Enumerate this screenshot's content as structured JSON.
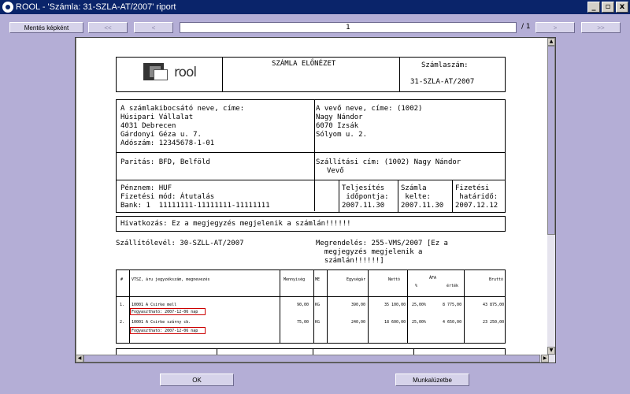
{
  "window": {
    "title": "ROOL  - 'Számla: 31-SZLA-AT/2007' riport",
    "controls": {
      "minimize": "_",
      "restore": "▫",
      "close": "x"
    }
  },
  "toolbar": {
    "save_image_label": "Mentés képként",
    "first_label": "<<",
    "prev_label": "<",
    "page_value": "1",
    "page_total": "/ 1",
    "next_label": ">",
    "last_label": ">>"
  },
  "invoice": {
    "logo_text": "rool",
    "preview_title": "SZÁMLA ELŐNÉZET",
    "invoice_no_label": "Számlaszám:",
    "invoice_no": "31-SZLA-AT/2007",
    "seller_header": "A számlakibocsátó neve, címe:",
    "seller_lines": [
      "Húsipari Vállalat",
      "4031 Debrecen",
      "Gárdonyi Géza u. 7.",
      "Adószám: 12345678-1-01"
    ],
    "buyer_header": "A vevő neve, címe: (1002)",
    "buyer_lines": [
      "Nagy Nándor",
      "6070 Izsák",
      "Sólyom u. 2."
    ],
    "parity": "Paritás: BFD, Belföld",
    "shipping_line1": "Szállítási cím: (1002) Nagy Nándor",
    "shipping_line2": "Vevő",
    "currency": "Pénznem: HUF",
    "payment_method": "Fizetési mód: Átutalás",
    "bank": "Bank: 1  11111111-11111111-11111111",
    "completion_label1": "Teljesítés",
    "completion_label2": " időpontja:",
    "completion_date": "2007.11.30",
    "issue_label1": "Számla",
    "issue_label2": " kelte:",
    "issue_date": "2007.11.30",
    "due_label1": "Fizetési",
    "due_label2": " határidő:",
    "due_date": "2007.12.12",
    "reference": "Hivatkozás: Ez a megjegyzés megjelenik a számlán!!!!!!",
    "delivery_note": "Szállítólevél: 30-SZLL-AT/2007",
    "order_line1": "Megrendelés: 255-VMS/2007 [Ez a",
    "order_line2": "  megjegyzés megjelenik a",
    "order_line3": "  számlán!!!!!!]"
  },
  "items_table": {
    "headers": {
      "no": "#",
      "item": "VTSZ, áru jegyzékszám, megnevezés",
      "qty": "Mennyiség",
      "unit": "ME",
      "unit_price": "Egységár",
      "net": "Nettó",
      "vat": "ÁFA",
      "vat_rate": "%",
      "vat_amount": "érték",
      "gross": "Bruttó"
    },
    "rows": [
      {
        "no": "1.",
        "item": "10001 A Csirke mell",
        "qty": "90,00",
        "unit": "KG",
        "unit_price": "390,00",
        "net": "35 100,00",
        "vat_rate": "25,00%",
        "vat_amount": "8 775,00",
        "gross": "43 875,00",
        "expiry": "Fogyasztható: 2007-12-06 nap"
      },
      {
        "no": "2.",
        "item": "10001 A Csirke szárny cb.",
        "qty": "75,00",
        "unit": "KG",
        "unit_price": "240,00",
        "net": "18 600,00",
        "vat_rate": "25,00%",
        "vat_amount": "4 650,00",
        "gross": "23 250,00",
        "expiry": "Fogyasztható: 2007-12-06 nap"
      }
    ]
  },
  "buttons": {
    "ok_label": "OK",
    "worksheet_label": "Munkalúzetbe"
  }
}
